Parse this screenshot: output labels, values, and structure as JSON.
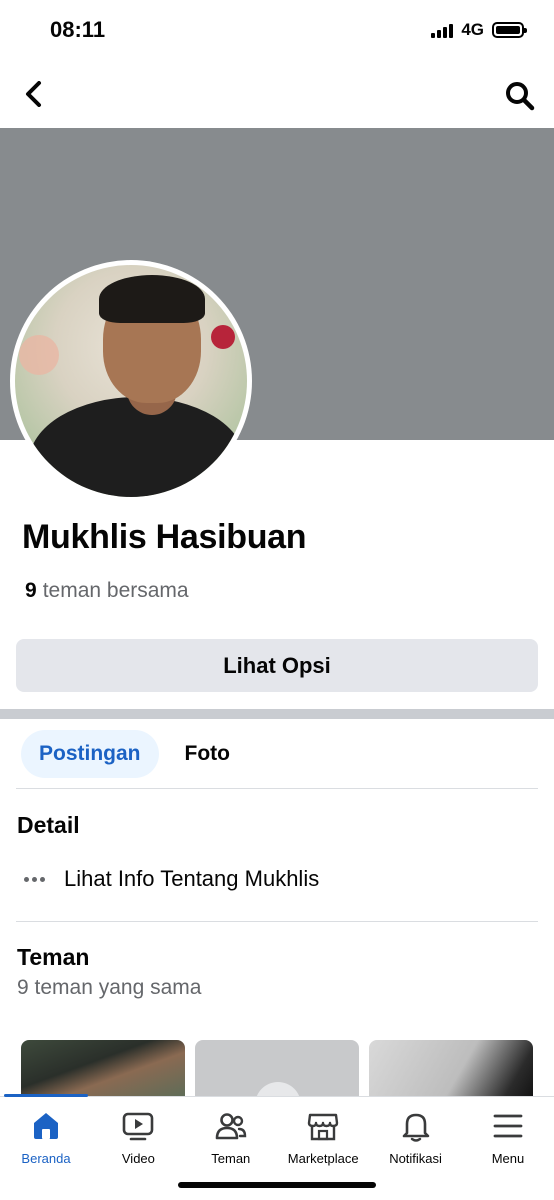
{
  "status_bar": {
    "time": "08:11",
    "network": "4G"
  },
  "profile": {
    "name": "Mukhlis Hasibuan",
    "mutual_count": "9",
    "mutual_label": "teman bersama",
    "options_button": "Lihat Opsi"
  },
  "tabs": [
    {
      "label": "Postingan",
      "active": true
    },
    {
      "label": "Foto",
      "active": false
    }
  ],
  "details": {
    "title": "Detail",
    "info_link": "Lihat Info Tentang Mukhlis"
  },
  "friends": {
    "title": "Teman",
    "subtitle": "9 teman yang sama"
  },
  "bottom_nav": [
    {
      "label": "Beranda",
      "icon": "home-icon",
      "active": true
    },
    {
      "label": "Video",
      "icon": "video-icon",
      "active": false
    },
    {
      "label": "Teman",
      "icon": "friends-icon",
      "active": false
    },
    {
      "label": "Marketplace",
      "icon": "marketplace-icon",
      "active": false
    },
    {
      "label": "Notifikasi",
      "icon": "bell-icon",
      "active": false
    },
    {
      "label": "Menu",
      "icon": "menu-icon",
      "active": false
    }
  ],
  "colors": {
    "accent": "#1b62c4",
    "cover": "#878b8e",
    "button_bg": "#e4e6eb"
  }
}
